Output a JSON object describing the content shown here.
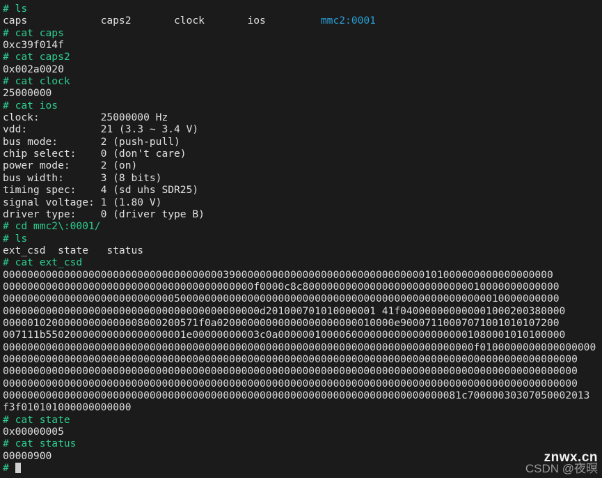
{
  "terminal": {
    "prompt_symbol": "#",
    "colors": {
      "background": "#1b1b1b",
      "prompt": "#2ecc8f",
      "output": "#e0e0e0",
      "directory": "#2a9fd6",
      "cursor": "#d0d0d0"
    },
    "cursor_visible": true
  },
  "session": {
    "cmd_ls_1": "# ls",
    "ls_output_1": {
      "entries": [
        "caps",
        "caps2",
        "clock",
        "ios",
        "mmc2:0001"
      ],
      "padded": "caps            caps2       clock       ios         ",
      "dir_entry": "mmc2:0001"
    },
    "cmd_cat_caps": "# cat caps",
    "out_caps": "0xc39f014f",
    "cmd_cat_caps2": "# cat caps2",
    "out_caps2": "0x002a0020",
    "cmd_cat_clock": "# cat clock",
    "out_clock": "25000000",
    "cmd_cat_ios": "# cat ios",
    "ios": [
      "clock:          25000000 Hz",
      "vdd:            21 (3.3 ~ 3.4 V)",
      "bus mode:       2 (push-pull)",
      "chip select:    0 (don't care)",
      "power mode:     2 (on)",
      "bus width:      3 (8 bits)",
      "timing spec:    4 (sd uhs SDR25)",
      "signal voltage: 1 (1.80 V)",
      "driver type:    0 (driver type B)"
    ],
    "cmd_cd": "# cd mmc2\\:0001/",
    "cmd_ls_2": "# ls",
    "ls_output_2": "ext_csd  state   status",
    "cmd_cat_extcsd": "# cat ext_csd",
    "ext_csd_lines": [
      "000000000000000000000000000000000000390000000000000000000000000000000101000000000000000000",
      "00000000000000000000000000000000000000000f0000c8c800000000000000000000000000010000000000000",
      "0000000000000000000000000000500000000000000000000000000000000000000000000000000010000000000",
      "000000000000000000000000000000000000000000d201000701010000001 41f040000000000001000200380000",
      "00000102000000000000008000200571f0a02000000000000000000000010000e90007110007071001010107200",
      "007111b55020000000000000000001e00000000003c0a00000010000600000000000000000001080001010100000",
      "00000000000000000000000000000000000000000000000000000000000000000000000000000f0100000000000000000",
      "0000000000000000000000000000000000000000000000000000000000000000000000000000000000000000000000",
      "0000000000000000000000000000000000000000000000000000000000000000000000000000000000000000000000",
      "0000000000000000000000000000000000000000000000000000000000000000000000000000000000000000000000",
      "000000000000000000000000000000000000000000000000000000000000000000000000081c70000030307050002013",
      "f3f010101000000000000"
    ],
    "cmd_cat_state": "# cat state",
    "out_state": "0x00000005",
    "cmd_cat_status": "# cat status",
    "out_status": "00000900",
    "final_prompt": "# "
  },
  "watermark": {
    "main": "znwx.cn",
    "sub": "CSDN @夜暝"
  }
}
